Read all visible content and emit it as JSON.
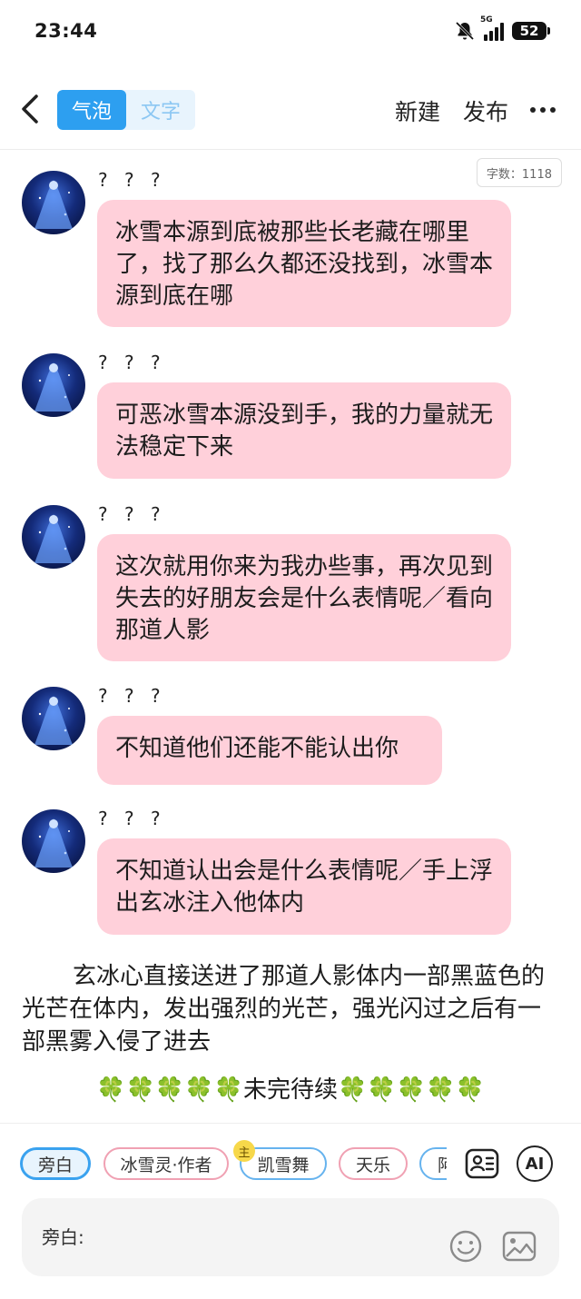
{
  "status_bar": {
    "time": "23:44",
    "network": "5G",
    "battery": "52",
    "icons": [
      "bell-muted-icon",
      "signal-icon",
      "battery-icon"
    ]
  },
  "header": {
    "back_icon": "chevron-left-icon",
    "tabs": [
      {
        "label": "气泡",
        "active": true
      },
      {
        "label": "文字",
        "active": false
      }
    ],
    "new_label": "新建",
    "publish_label": "发布",
    "more_icon": "more-horizontal-icon"
  },
  "word_count": "字数：1118",
  "messages": [
    {
      "speaker": "? ? ?",
      "text": "冰雪本源到底被那些长老藏在哪里了，找了那么久都还没找到，冰雪本源到底在哪"
    },
    {
      "speaker": "? ? ?",
      "text": "可恶冰雪本源没到手，我的力量就无法稳定下来"
    },
    {
      "speaker": "? ? ?",
      "text": "这次就用你来为我办些事，再次见到失去的好朋友会是什么表情呢／看向那道人影"
    },
    {
      "speaker": "? ? ?",
      "text": "不知道他们还能不能认出你"
    },
    {
      "speaker": "? ? ?",
      "text": "不知道认出会是什么表情呢／手上浮出玄冰注入他体内"
    }
  ],
  "narration": "玄冰心直接送进了那道人影体内一部黑蓝色的光芒在体内，发出强烈的光芒，强光闪过之后有一部黑雾入侵了进去",
  "ending": {
    "clovers_left": "🍀🍀🍀🍀🍀",
    "text": "未完待续",
    "clovers_right": "🍀🍀🍀🍀🍀"
  },
  "bottom_panel": {
    "role_chips": [
      {
        "label": "旁白",
        "selected": true
      },
      {
        "label": "冰雪灵·作者",
        "selected": false
      },
      {
        "label": "凯雪舞",
        "selected": false,
        "main": true
      },
      {
        "label": "天乐",
        "selected": false
      },
      {
        "label": "阿",
        "selected": false
      }
    ],
    "main_badge": "主",
    "role_card_icon": "role-card-icon",
    "ai_label": "AI",
    "input_label": "旁白:",
    "emoji_icon": "emoji-icon",
    "image_icon": "image-icon"
  }
}
